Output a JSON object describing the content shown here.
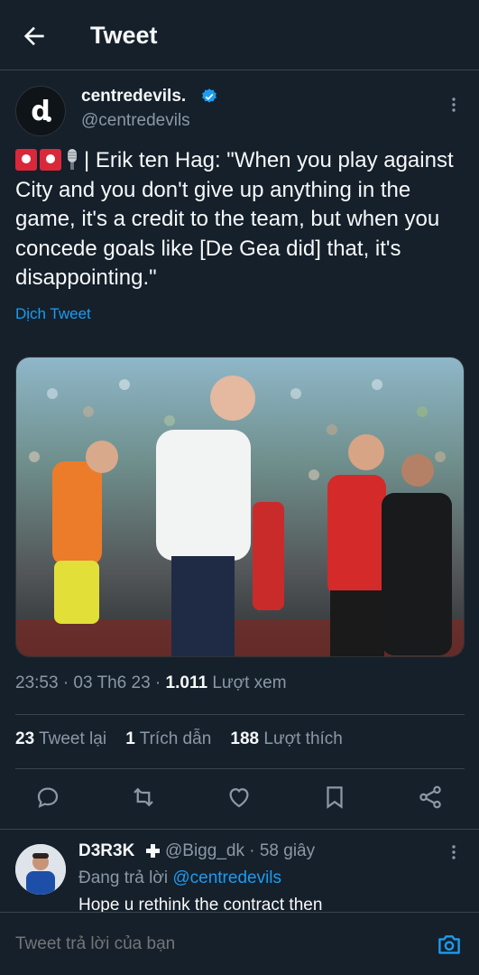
{
  "header": {
    "title": "Tweet"
  },
  "tweet": {
    "author_name": "centredevils.",
    "author_handle": "@centredevils",
    "avatar_letter": "d",
    "text": "| Erik ten Hag: \"When you play against City and you don't give up anything in the game, it's a credit to the team, but when you concede goals like [De Gea did] that, it's disappointing.\"",
    "translate_label": "Dịch Tweet",
    "time": "23:53 · 03 Th6 23 · ",
    "views_count": "1.011",
    "views_label": " Lượt xem",
    "retweets_count": "23",
    "retweets_label": " Tweet lại",
    "quotes_count": "1",
    "quotes_label": " Trích dẫn",
    "likes_count": "188",
    "likes_label": " Lượt thích"
  },
  "actions": [
    "reply-icon",
    "retweet-icon",
    "like-icon",
    "bookmark-icon",
    "share-icon"
  ],
  "reply": {
    "name": "D3R3K",
    "handle": "@Bigg_dk · 58 giây",
    "replying_prefix": "Đang trả lời ",
    "replying_to": "@centredevils",
    "text": "Hope u rethink the contract then"
  },
  "composer": {
    "placeholder": "Tweet trả lời của bạn"
  },
  "colors": {
    "background": "#15202b",
    "accent": "#1d9bf0",
    "muted": "#8b98a5",
    "divider": "#38444d"
  }
}
